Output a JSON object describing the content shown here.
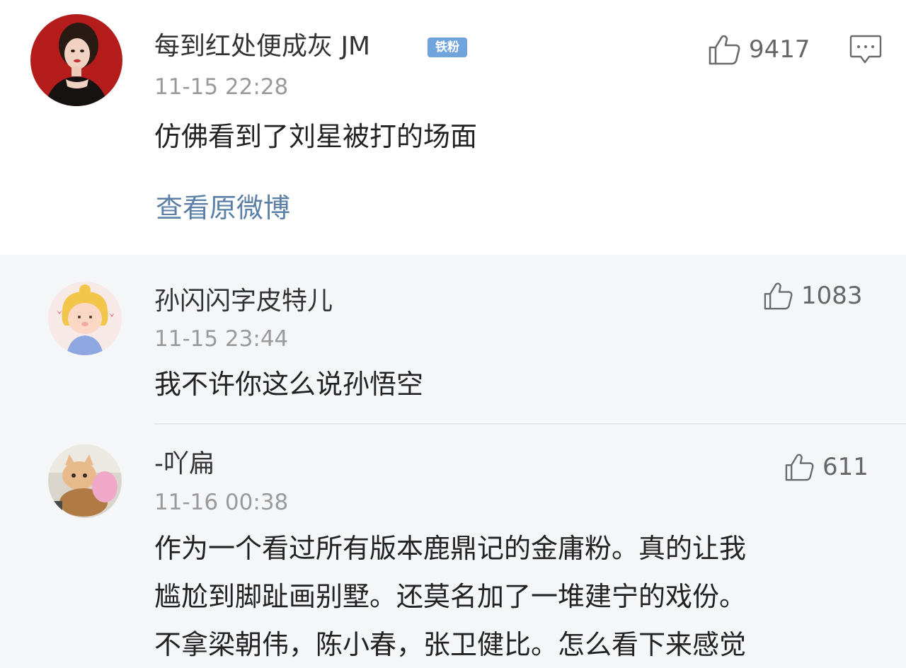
{
  "main_comment": {
    "username": "每到红处便成灰 JM",
    "badge": "铁粉",
    "timestamp": "11-15 22:28",
    "content": "仿佛看到了刘星被打的场面",
    "likes": "9417",
    "view_original_label": "查看原微博",
    "avatar_icon": "user-avatar-woman-red-background"
  },
  "replies": [
    {
      "username": "孙闪闪字皮特儿",
      "timestamp": "11-15 23:44",
      "content_lines": [
        "我不许你这么说孙悟空"
      ],
      "likes": "1083",
      "avatar_icon": "user-avatar-cartoon-girl"
    },
    {
      "username": "-吖扁",
      "timestamp": "11-16 00:38",
      "content_lines": [
        "作为一个看过所有版本鹿鼎记的金庸粉。真的让我",
        "尴尬到脚趾画别墅。还莫名加了一堆建宁的戏份。",
        "不拿梁朝伟，陈小春，张卫健比。怎么看下来感觉"
      ],
      "likes": "611",
      "avatar_icon": "user-avatar-cat-photo"
    }
  ],
  "icons": {
    "like": "thumbs-up-icon",
    "comment": "comment-bubble-icon"
  },
  "colors": {
    "link": "#5b7fa6",
    "badge": "#6fa4dc",
    "reply_background": "#f5f6f8",
    "timestamp": "#9a9a9a"
  }
}
